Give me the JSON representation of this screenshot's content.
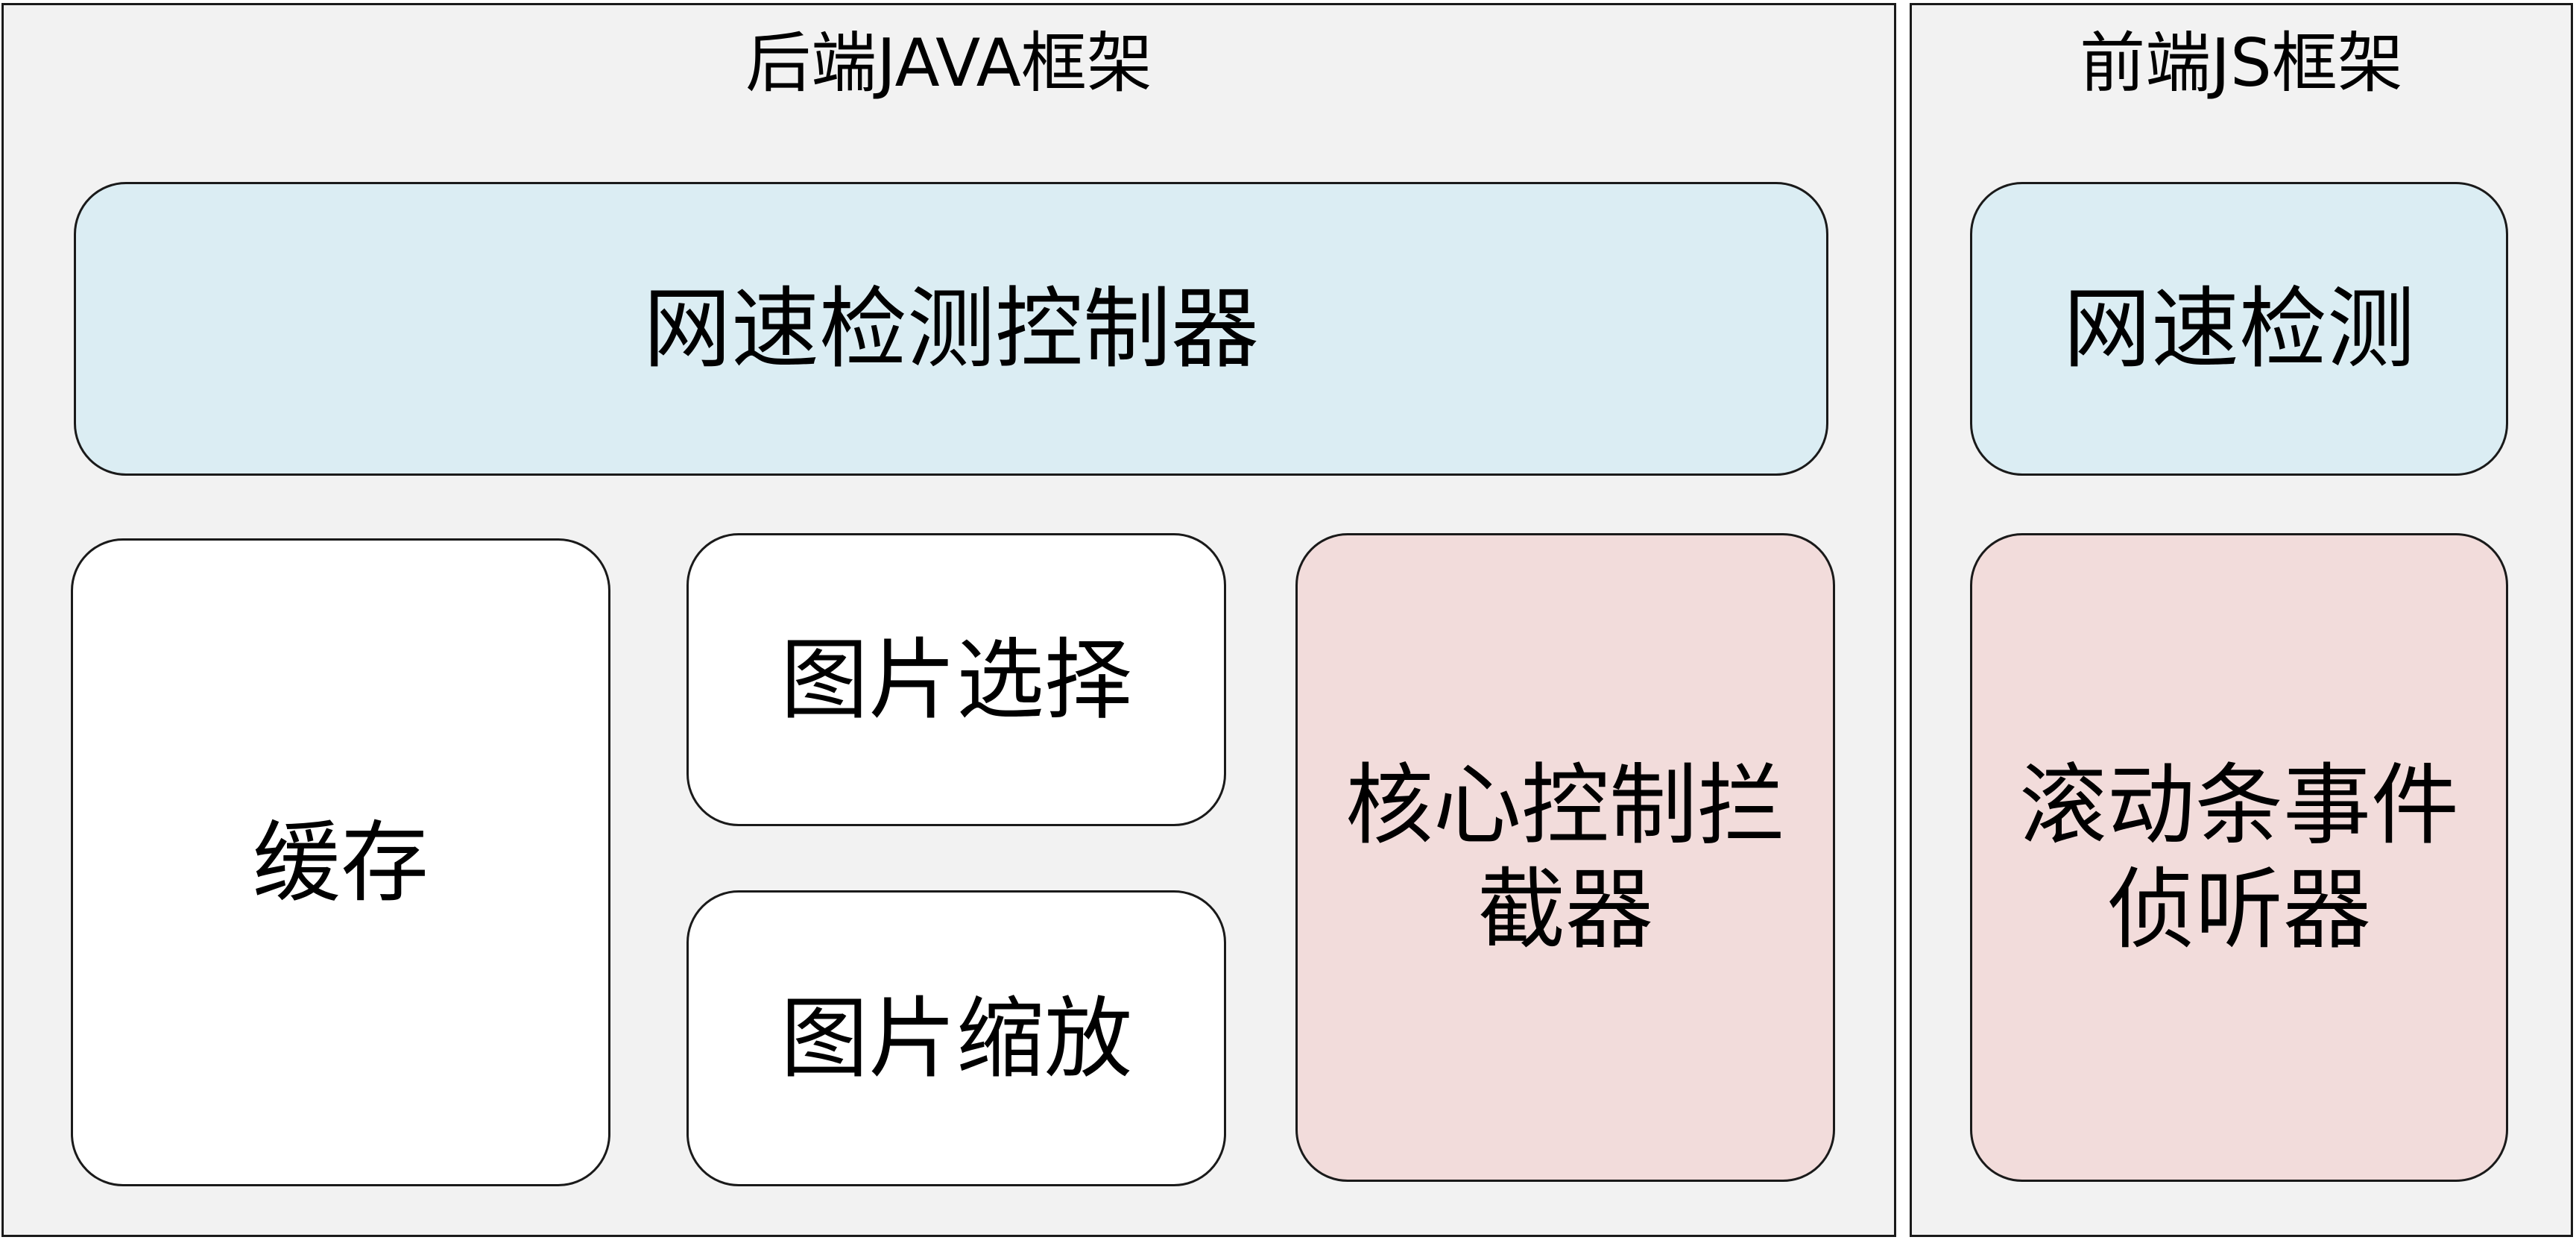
{
  "backend": {
    "title": "后端JAVA框架",
    "speed_controller": "网速检测控制器",
    "cache": "缓存",
    "image_select": "图片选择",
    "image_zoom": "图片缩放",
    "interceptor_line1": "核心控制拦",
    "interceptor_line2": "截器"
  },
  "frontend": {
    "title": "前端JS框架",
    "speed_detect": "网速检测",
    "scroll_listener_line1": "滚动条事件",
    "scroll_listener_line2": "侦听器"
  },
  "colors": {
    "panel_bg": "#f2f2f2",
    "blue_box": "#dbedf3",
    "white_box": "#ffffff",
    "pink_box": "#f2dcdb",
    "border": "#1a1a1a"
  }
}
